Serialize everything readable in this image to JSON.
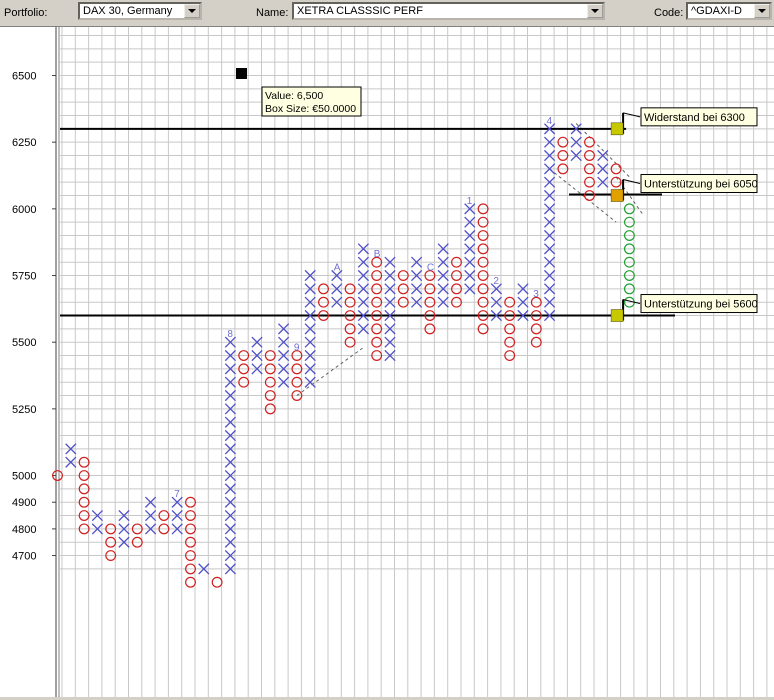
{
  "toolbar": {
    "portfolio_label": "Portfolio:",
    "portfolio_value": "DAX 30, Germany",
    "name_label": "Name:",
    "name_value": "XETRA CLASSSIC PERF",
    "code_label": "Code:",
    "code_value": "^GDAXI-D"
  },
  "tooltip": {
    "line1": "Value: 6,500",
    "line2": "Box Size: €50.0000"
  },
  "annotations": [
    {
      "label": "Widerstand bei 6300",
      "value": 6300
    },
    {
      "label": "Unterstützung bei 6050",
      "value": 6050
    },
    {
      "label": "Unterstützung bei 5600",
      "value": 5600
    }
  ],
  "chart_data": {
    "type": "point-and-figure",
    "box_size": 50,
    "y_ticks": [
      {
        "label": "6500",
        "value": 6500
      },
      {
        "label": "6250",
        "value": 6250
      },
      {
        "label": "6000",
        "value": 6000
      },
      {
        "label": "5750",
        "value": 5750
      },
      {
        "label": "5500",
        "value": 5500
      },
      {
        "label": "5250",
        "value": 5250
      },
      {
        "label": "5000",
        "value": 5000
      },
      {
        "label": "4900",
        "value": 4900
      },
      {
        "label": "4800",
        "value": 4800
      },
      {
        "label": "4700",
        "value": 4700
      }
    ],
    "y_range": [
      4620,
      6690
    ],
    "resistance_line": 6300,
    "support_lines": [
      5600
    ],
    "columns": [
      {
        "type": "O",
        "low": 5000,
        "high": 5000,
        "marker": ""
      },
      {
        "type": "X",
        "low": 5050,
        "high": 5100,
        "marker": ""
      },
      {
        "type": "O",
        "low": 4800,
        "high": 5050,
        "marker": ""
      },
      {
        "type": "X",
        "low": 4800,
        "high": 4850,
        "marker": ""
      },
      {
        "type": "O",
        "low": 4700,
        "high": 4800,
        "marker": ""
      },
      {
        "type": "X",
        "low": 4750,
        "high": 4850,
        "marker": ""
      },
      {
        "type": "O",
        "low": 4750,
        "high": 4800,
        "marker": ""
      },
      {
        "type": "X",
        "low": 4800,
        "high": 4900,
        "marker": ""
      },
      {
        "type": "O",
        "low": 4800,
        "high": 4850,
        "marker": ""
      },
      {
        "type": "X",
        "low": 4800,
        "high": 4900,
        "marker": "7"
      },
      {
        "type": "O",
        "low": 4600,
        "high": 4900,
        "marker": ""
      },
      {
        "type": "X",
        "low": 4650,
        "high": 4650,
        "marker": ""
      },
      {
        "type": "O",
        "low": 4600,
        "high": 4600,
        "marker": ""
      },
      {
        "type": "X",
        "low": 4650,
        "high": 5500,
        "marker": "8"
      },
      {
        "type": "O",
        "low": 5350,
        "high": 5450,
        "marker": ""
      },
      {
        "type": "X",
        "low": 5400,
        "high": 5500,
        "marker": ""
      },
      {
        "type": "O",
        "low": 5250,
        "high": 5450,
        "marker": ""
      },
      {
        "type": "X",
        "low": 5350,
        "high": 5550,
        "marker": ""
      },
      {
        "type": "O",
        "low": 5300,
        "high": 5450,
        "marker": "9"
      },
      {
        "type": "X",
        "low": 5350,
        "high": 5750,
        "marker": ""
      },
      {
        "type": "O",
        "low": 5600,
        "high": 5700,
        "marker": ""
      },
      {
        "type": "X",
        "low": 5650,
        "high": 5750,
        "marker": "A"
      },
      {
        "type": "O",
        "low": 5500,
        "high": 5700,
        "marker": ""
      },
      {
        "type": "X",
        "low": 5550,
        "high": 5850,
        "marker": ""
      },
      {
        "type": "O",
        "low": 5450,
        "high": 5800,
        "marker": "B"
      },
      {
        "type": "X",
        "low": 5450,
        "high": 5800,
        "marker": ""
      },
      {
        "type": "O",
        "low": 5650,
        "high": 5750,
        "marker": ""
      },
      {
        "type": "X",
        "low": 5650,
        "high": 5800,
        "marker": ""
      },
      {
        "type": "O",
        "low": 5550,
        "high": 5750,
        "marker": "C"
      },
      {
        "type": "X",
        "low": 5650,
        "high": 5850,
        "marker": ""
      },
      {
        "type": "O",
        "low": 5650,
        "high": 5800,
        "marker": ""
      },
      {
        "type": "X",
        "low": 5700,
        "high": 6000,
        "marker": "1"
      },
      {
        "type": "O",
        "low": 5550,
        "high": 6000,
        "marker": ""
      },
      {
        "type": "X",
        "low": 5600,
        "high": 5700,
        "marker": "2"
      },
      {
        "type": "O",
        "low": 5450,
        "high": 5650,
        "marker": ""
      },
      {
        "type": "X",
        "low": 5600,
        "high": 5700,
        "marker": ""
      },
      {
        "type": "O",
        "low": 5500,
        "high": 5650,
        "marker": "3"
      },
      {
        "type": "X",
        "low": 5600,
        "high": 6300,
        "marker": "4"
      },
      {
        "type": "O",
        "low": 6150,
        "high": 6250,
        "marker": ""
      },
      {
        "type": "X",
        "low": 6200,
        "high": 6300,
        "marker": ""
      },
      {
        "type": "O",
        "low": 6050,
        "high": 6250,
        "marker": ""
      },
      {
        "type": "X",
        "low": 6100,
        "high": 6200,
        "marker": ""
      },
      {
        "type": "O",
        "low": 6050,
        "high": 6150,
        "marker": ""
      },
      {
        "type": "O-projected",
        "low": 5650,
        "high": 6000,
        "marker": ""
      }
    ]
  },
  "colors": {
    "x_mark": "#5050c8",
    "o_mark": "#d02020",
    "o_projected": "#20a030",
    "grid": "#c8c8c8",
    "marker_text": "#7070d0",
    "flag_yellow": "#c8c800",
    "flag_orange": "#e0a000",
    "label_bg": "#ffffe1"
  }
}
